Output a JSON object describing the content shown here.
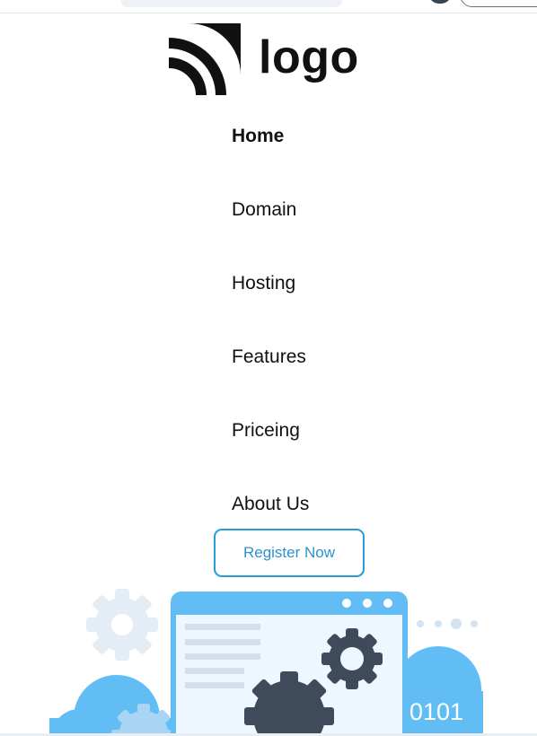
{
  "brand": {
    "logo_text": "logo",
    "logo_icon": "wifi-rss-logo-icon"
  },
  "nav": {
    "items": [
      {
        "label": "Home",
        "active": true
      },
      {
        "label": "Domain",
        "active": false
      },
      {
        "label": "Hosting",
        "active": false
      },
      {
        "label": "Features",
        "active": false
      },
      {
        "label": "Priceing",
        "active": false
      },
      {
        "label": "About Us",
        "active": false
      }
    ]
  },
  "cta": {
    "register_label": "Register Now"
  },
  "hero": {
    "binary_text": "0101",
    "illustration": "cloud-hosting-gears-illustration"
  },
  "colors": {
    "accent": "#2b9bd8",
    "cloud": "#63bdf5",
    "gear_dark": "#3f4a5a",
    "gear_light": "#e4edf5"
  }
}
